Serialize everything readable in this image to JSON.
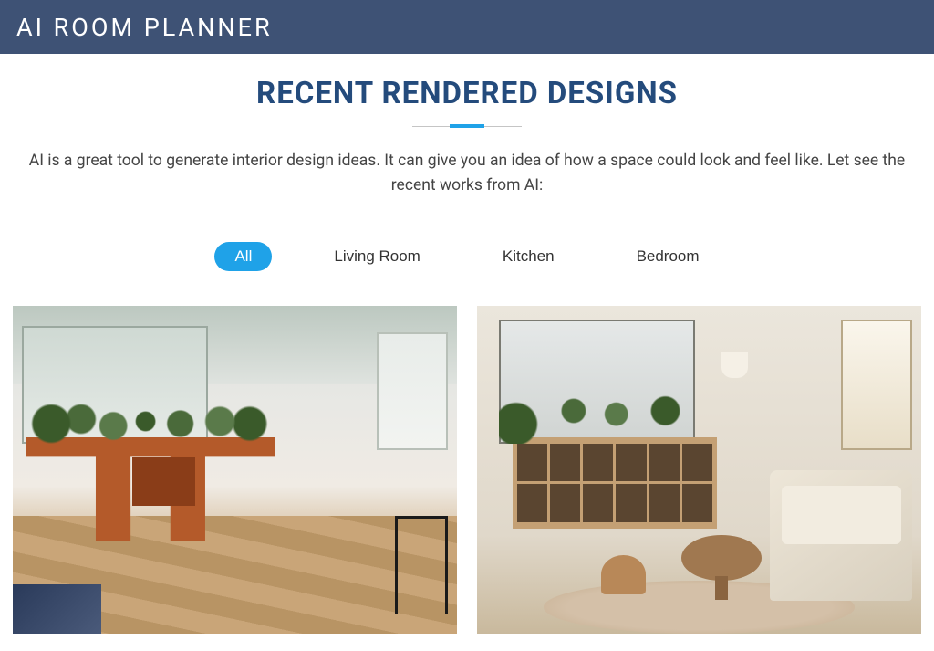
{
  "header": {
    "title": "AI ROOM PLANNER"
  },
  "section": {
    "title": "RECENT RENDERED DESIGNS",
    "description": "AI is a great tool to generate interior design ideas. It can give you an idea of how a space could look and feel like. Let see the recent works from AI:"
  },
  "filters": {
    "items": [
      {
        "label": "All",
        "active": true
      },
      {
        "label": "Living Room",
        "active": false
      },
      {
        "label": "Kitchen",
        "active": false
      },
      {
        "label": "Bedroom",
        "active": false
      }
    ]
  },
  "gallery": {
    "cards": [
      {
        "alt": "room-before"
      },
      {
        "alt": "room-after"
      }
    ]
  },
  "colors": {
    "headerBg": "#3e5275",
    "accent": "#1fa2e8",
    "titleColor": "#244b7c"
  }
}
